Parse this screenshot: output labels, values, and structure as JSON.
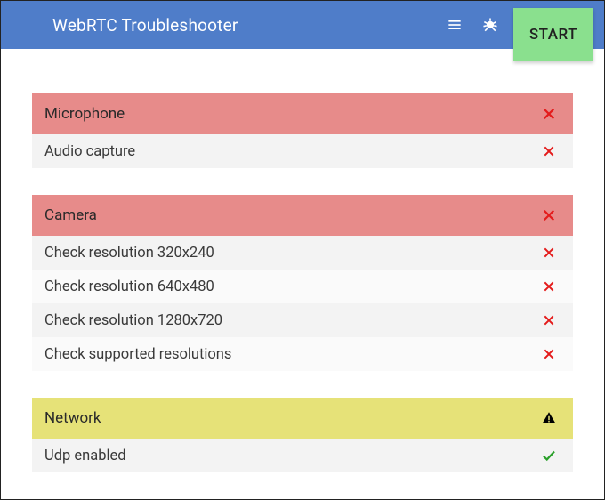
{
  "header": {
    "title": "WebRTC Troubleshooter",
    "start_label": "START"
  },
  "sections": [
    {
      "name": "Microphone",
      "status": "fail",
      "items": [
        {
          "label": "Audio capture",
          "status": "fail"
        }
      ]
    },
    {
      "name": "Camera",
      "status": "fail",
      "items": [
        {
          "label": "Check resolution 320x240",
          "status": "fail"
        },
        {
          "label": "Check resolution 640x480",
          "status": "fail"
        },
        {
          "label": "Check resolution 1280x720",
          "status": "fail"
        },
        {
          "label": "Check supported resolutions",
          "status": "fail"
        }
      ]
    },
    {
      "name": "Network",
      "status": "warn",
      "items": [
        {
          "label": "Udp enabled",
          "status": "pass"
        }
      ]
    }
  ]
}
